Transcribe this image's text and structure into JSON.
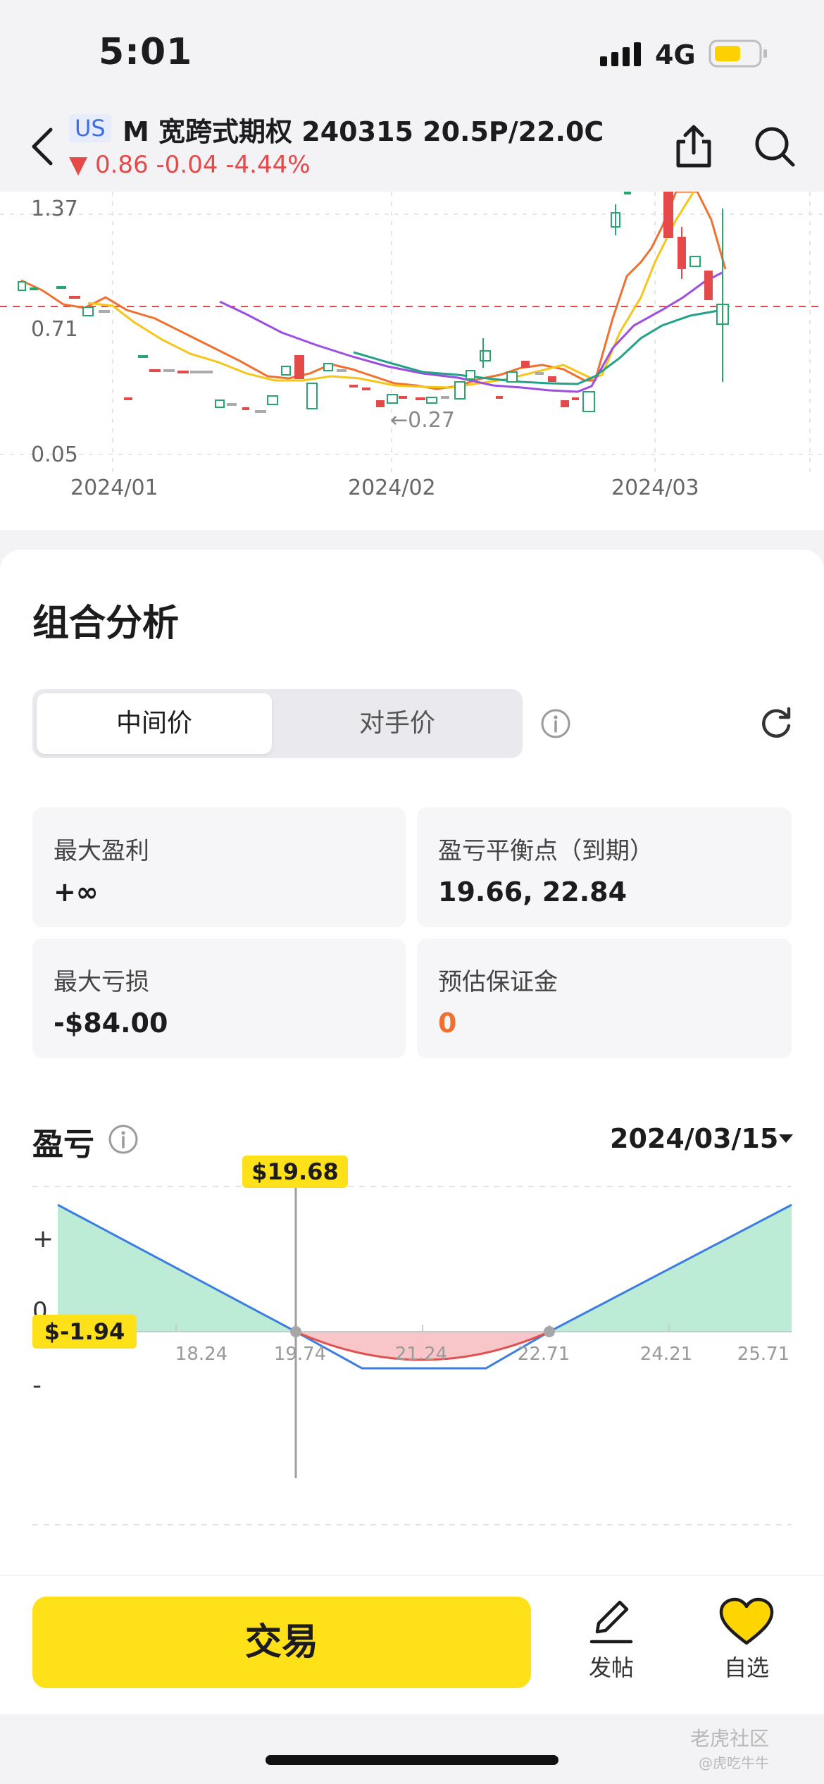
{
  "status_bar": {
    "time": "5:01",
    "network": "4G"
  },
  "header": {
    "market": "US",
    "title": "M 宽跨式期权 240315 20.5P/22.0C",
    "quote": "0.86 -0.04 -4.44%",
    "down_color": "#e54a4a",
    "icons": [
      "back-icon",
      "share-icon",
      "search-icon"
    ]
  },
  "kline": {
    "y_labels": [
      "1.37",
      "0.71",
      "0.05"
    ],
    "x_labels": [
      "2024/01",
      "2024/02",
      "2024/03"
    ],
    "min_marker": "←0.27",
    "up_color": "#25a86f",
    "down_color": "#e54a4a",
    "ma_colors": [
      "#f07030",
      "#f5c518",
      "#9b4ee0",
      "#24a189"
    ]
  },
  "analysis": {
    "title": "组合分析",
    "segment": {
      "mid": "中间价",
      "opp": "对手价",
      "selected": "中间价"
    },
    "stats": {
      "max_profit_label": "最大盈利",
      "max_profit": "+∞",
      "breakeven_label": "盈亏平衡点（到期）",
      "breakeven": "19.66, 22.84",
      "max_loss_label": "最大亏损",
      "max_loss": "-$84.00",
      "margin_label": "预估保证金",
      "margin": "0",
      "margin_color": "#f07030"
    }
  },
  "pl": {
    "title": "盈亏",
    "date": "2024/03/15",
    "plus": "+",
    "zero": "0",
    "minus": "-",
    "cursor_price": "$19.68",
    "cursor_pl": "$-1.94",
    "x_ticks": [
      "18.24",
      "19.74",
      "21.24",
      "22.71",
      "24.21",
      "25.71"
    ],
    "profit_fill": "#bcecd6",
    "loss_fill": "#f8c6c8",
    "line_color": "#3b7de0",
    "current_color": "#e0504e"
  },
  "bottom": {
    "trade": "交易",
    "post": "发帖",
    "watchlist": "自选",
    "brand_color": "#ffe11a"
  },
  "watermark": {
    "line1": "老虎社区",
    "line2": "@虎吃牛牛"
  }
}
